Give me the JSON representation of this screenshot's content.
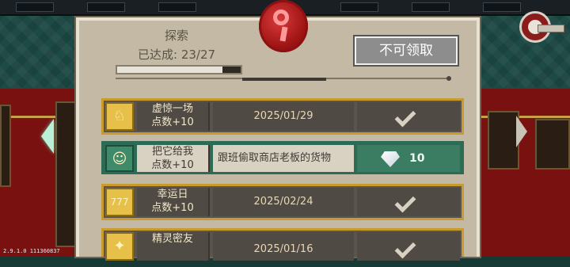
{
  "header": {
    "title": "探索",
    "achieved": "已达成: 23/27",
    "progress": 0.85,
    "claim_button": "不可领取"
  },
  "rows": [
    {
      "name": "虚惊一场\n点数+10",
      "detail": "2025/01/29",
      "status": "claimed",
      "icon": "bell-icon"
    },
    {
      "name": "把它给我\n点数+10",
      "detail": "跟班偷取商店老板的货物",
      "status": "reward",
      "reward_value": "10",
      "icon": "thief-icon"
    },
    {
      "name": "幸运日\n点数+10",
      "detail": "2025/02/24",
      "status": "claimed",
      "icon": "slot-777-icon"
    },
    {
      "name": "精灵密友",
      "detail": "2025/01/16",
      "status": "claimed",
      "icon": "elf-icon"
    }
  ],
  "version": "2.9.1.0 111360837",
  "colors": {
    "panel": "#c3b9a4",
    "gold_border": "#c99a2e",
    "active_green": "#2e6b55",
    "seal_red": "#a01515"
  }
}
